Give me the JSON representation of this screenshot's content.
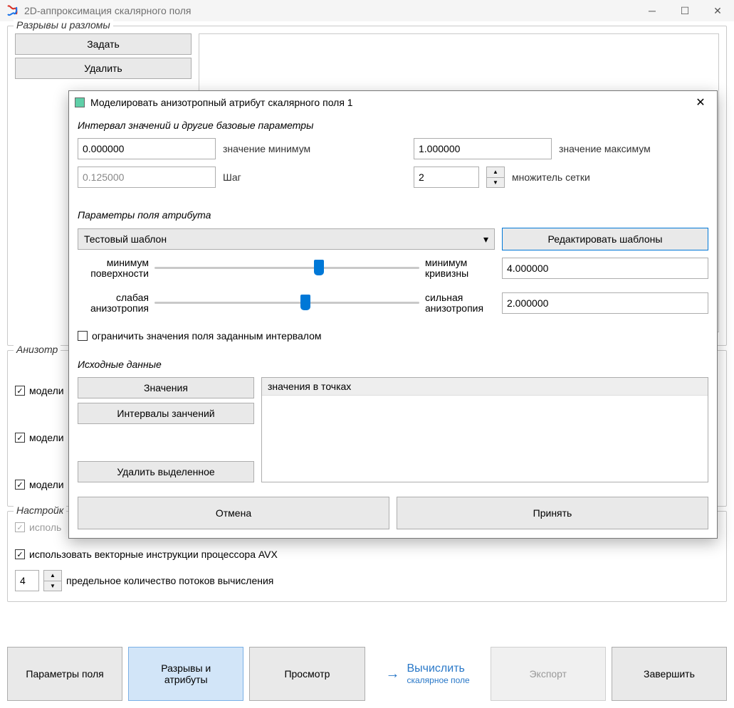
{
  "window": {
    "title": "2D-аппроксимация скалярного поля"
  },
  "breaks": {
    "legend": "Разрывы и разломы",
    "set_btn": "Задать",
    "delete_btn": "Удалить"
  },
  "anisotropy": {
    "legend": "Анизотр",
    "model1": "модели",
    "model2": "модели",
    "model3": "модели"
  },
  "settings": {
    "legend": "Настройк",
    "use_disabled_label": "исполь",
    "use_avx_label": "использовать векторные инструкции процессора AVX",
    "threads_value": "4",
    "threads_label": "предельное количество потоков вычисления"
  },
  "nav": {
    "params": "Параметры поля",
    "breaks": "Разрывы и\nатрибуты",
    "view": "Просмотр",
    "compute": "Вычислить",
    "compute_sub": "скалярное поле",
    "export": "Экспорт",
    "finish": "Завершить"
  },
  "modal": {
    "title": "Моделировать анизотропный атрибут скалярного поля 1",
    "interval_heading": "Интервал значений и другие базовые параметры",
    "min_value": "0.000000",
    "min_label": "значение минимум",
    "max_value": "1.000000",
    "max_label": "значение максимум",
    "step_value": "0.125000",
    "step_label": "Шаг",
    "grid_mult_value": "2",
    "grid_mult_label": "множитель сетки",
    "attr_heading": "Параметры поля атрибута",
    "template_select": "Тестовый шаблон",
    "edit_templates_btn": "Редактировать шаблоны",
    "slider1_left": "минимум\nповерхности",
    "slider1_right": "минимум\nкривизны",
    "slider1_value": "4.000000",
    "slider2_left": "слабая\nанизотропия",
    "slider2_right": "сильная\nанизотропия",
    "slider2_value": "2.000000",
    "limit_checkbox": "ограничить значения поля заданным интервалом",
    "source_heading": "Исходные данные",
    "values_btn": "Значения",
    "intervals_btn": "Интервалы занчений",
    "delete_selected_btn": "Удалить выделенное",
    "list_item0": "значения в точках",
    "cancel_btn": "Отмена",
    "accept_btn": "Принять"
  }
}
